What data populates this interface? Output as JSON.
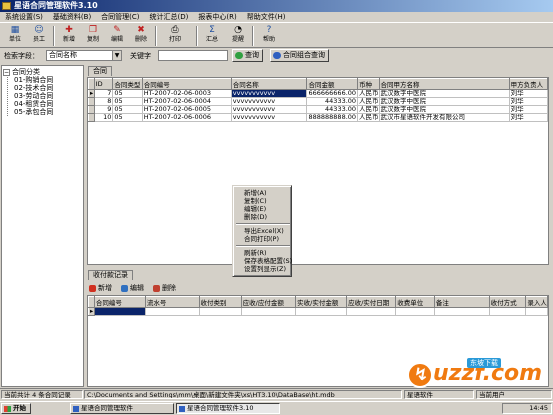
{
  "window": {
    "title": "星语合同管理软件3.10"
  },
  "menu": [
    "系统设置(S)",
    "基础资料(B)",
    "合同管理(C)",
    "统计汇总(D)",
    "报表中心(R)",
    "帮助文件(H)"
  ],
  "toolbar": [
    {
      "label": "单位",
      "icon": "unit-icon"
    },
    {
      "label": "员工",
      "icon": "staff-icon"
    },
    {
      "label": "新增",
      "icon": "add-icon"
    },
    {
      "label": "复制",
      "icon": "copy-icon"
    },
    {
      "label": "编辑",
      "icon": "edit-icon"
    },
    {
      "label": "删除",
      "icon": "delete-icon"
    },
    {
      "label": "打印",
      "icon": "print-icon"
    },
    {
      "label": "汇总",
      "icon": "summary-icon"
    },
    {
      "label": "提醒",
      "icon": "reminder-icon"
    },
    {
      "label": "帮助",
      "icon": "help-icon"
    }
  ],
  "query": {
    "field_label": "检索字段：",
    "field_value": "合同名称",
    "keyword_label": "关键字",
    "keyword_value": "",
    "query_button": "查询",
    "combo_query_button": "合同组合查询"
  },
  "tree": {
    "root": "合同分类",
    "items": [
      "01-购销合同",
      "02-技术合同",
      "03-劳动合同",
      "04-租赁合同",
      "05-承包合同"
    ]
  },
  "main_tab": "合同",
  "contracts": {
    "columns": [
      "ID",
      "合同类型",
      "合同编号",
      "合同名称",
      "合同金额",
      "币种",
      "合同甲方名称",
      "甲方负责人"
    ],
    "rows": [
      [
        "7",
        "05",
        "HT-2007-02-06-0003",
        "vvvvvvvvvvv",
        "666666666.00",
        "人民币",
        "武汉数字中医院",
        "刘华"
      ],
      [
        "8",
        "05",
        "HT-2007-02-06-0004",
        "vvvvvvvvvvv",
        "44333.00",
        "人民币",
        "武汉数字中医院",
        "刘华"
      ],
      [
        "9",
        "05",
        "HT-2007-02-06-0005",
        "vvvvvvvvvvv",
        "44333.00",
        "人民币",
        "武汉数字中医院",
        "刘华"
      ],
      [
        "10",
        "05",
        "HT-2007-02-06-0006",
        "vvvvvvvvvvv",
        "888888888.00",
        "人民币",
        "武汉市星语软件开发有限公司",
        "刘华"
      ]
    ]
  },
  "context_menu": {
    "items": [
      "新增(A)",
      "复制(C)",
      "编辑(E)",
      "删除(D)",
      "导出Excel(X)",
      "合同打印(P)",
      "刷新(R)",
      "保存表格配置(S)",
      "设置列显示(Z)"
    ]
  },
  "sub_tab": "收付款记录",
  "sub_toolbar": [
    {
      "label": "新增",
      "icon": "add-icon"
    },
    {
      "label": "编辑",
      "icon": "edit-icon"
    },
    {
      "label": "删除",
      "icon": "delete-icon"
    }
  ],
  "payments": {
    "columns": [
      "合同编号",
      "流水号",
      "收付类别",
      "应收/应付金额",
      "实收/实付金额",
      "应收/实付日期",
      "收费单位",
      "备注",
      "收付方式",
      "录入人"
    ]
  },
  "statusbar": {
    "count": "当前共计 4 条合同记录",
    "path": "C:\\Documents and Settings\\mm\\桌面\\新建文件夹\\xs\\HT3.10\\DataBase\\ht.mdb",
    "unit": "星语软件",
    "user": "当前用户"
  },
  "taskbar": {
    "start": "开始",
    "tasks": [
      "星语合同管理软件",
      "星语合同管理软件3.10"
    ],
    "clock": "14:45"
  },
  "watermark": {
    "brand": "uzzf.com",
    "tagline": "东坡下载"
  }
}
